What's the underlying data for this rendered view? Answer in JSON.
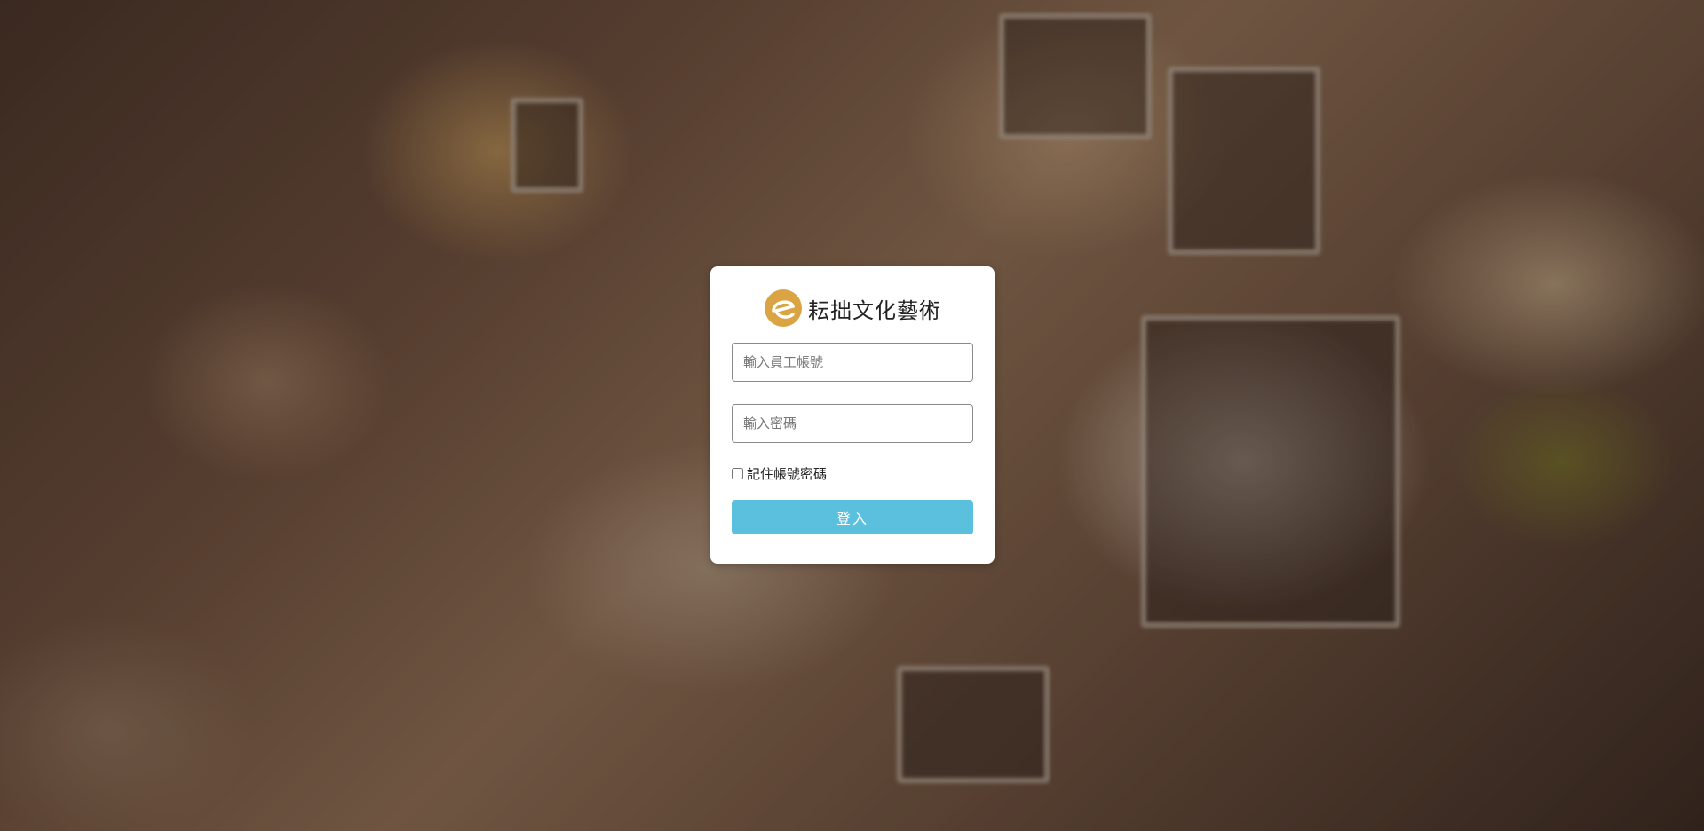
{
  "brand": {
    "name": "耘拙文化藝術",
    "logo_icon": "brand-e-logo",
    "logo_color": "#d9a441"
  },
  "login": {
    "username_placeholder": "輸入員工帳號",
    "password_placeholder": "輸入密碼",
    "username_value": "",
    "password_value": "",
    "remember_label": "記住帳號密碼",
    "remember_checked": false,
    "submit_label": "登入",
    "submit_color": "#5bc0de"
  }
}
